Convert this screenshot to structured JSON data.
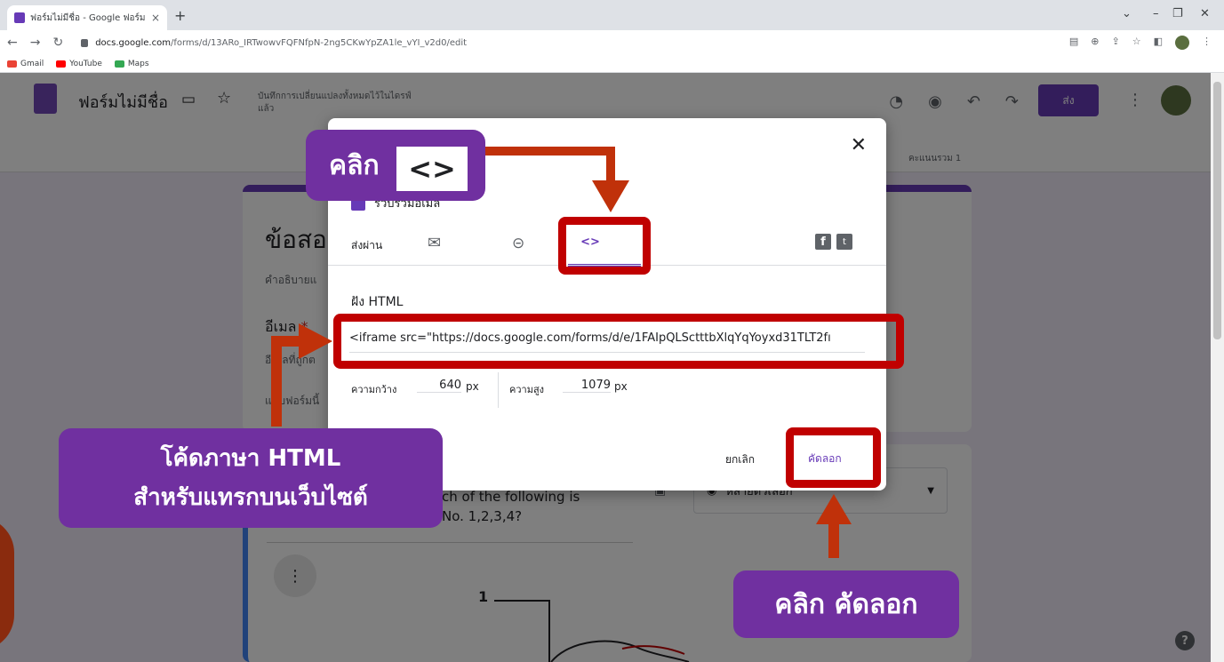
{
  "browser": {
    "tab_title": "ฟอร์มไม่มีชื่อ - Google ฟอร์ม",
    "tab_close": "×",
    "new_tab": "+",
    "url_host": "docs.google.com",
    "url_path": "/forms/d/13ARo_IRTwowvFQFNfpN-2ng5CKwYpZA1le_vYI_v2d0/edit",
    "bookmarks": [
      {
        "label": "Gmail",
        "color": "#ea4335"
      },
      {
        "label": "YouTube",
        "color": "#ff0000"
      },
      {
        "label": "Maps",
        "color": "#34a853"
      }
    ]
  },
  "forms": {
    "title": "ฟอร์มไม่มีชื่อ",
    "saved_note": "บันทึกการเปลี่ยนแปลงทั้งหมดไว้ในไดรฟ์แล้ว",
    "send_label": "ส่ง",
    "score_total": "คะแนนรวม 1",
    "section_title": "ข้อสอ",
    "description": "คำอธิบายแ",
    "email_label": "อีเมล",
    "email_required": "*",
    "email_hint": "อีเมลที่ถูกต",
    "form_hint": "แบบฟอร์มนี้",
    "question2_line1": "ch of the following is",
    "question2_line2": "No. 1,2,3,4?",
    "question2_type": "หลายตัวเลือก",
    "figure_number": "1",
    "more_label": "⋮",
    "help": "?"
  },
  "dialog": {
    "collect_email": "รวบรวมอีเมล",
    "send_via": "ส่งผ่าน",
    "embed_icon": "<>",
    "embed_title": "ฝัง HTML",
    "embed_code": "<iframe src=\"https://docs.google.com/forms/d/e/1FAIpQLSctttbXlqYqYoyxd31TLT2fı",
    "width_label": "ความกว้าง",
    "width_value": "640",
    "height_label": "ความสูง",
    "height_value": "1079",
    "unit": "px",
    "cancel_label": "ยกเลิก",
    "copy_label": "คัดลอก"
  },
  "annotations": {
    "click_label": "คลิก",
    "code_icon": "<>",
    "html_code_line1": "โค้ดภาษา HTML",
    "html_code_line2": "สำหรับแทรกบนเว็บไซต์",
    "click_copy": "คลิก คัดลอก"
  },
  "colors": {
    "accent": "#673ab7",
    "annotation_red": "#c00000",
    "annotation_purple": "#7030a0"
  }
}
